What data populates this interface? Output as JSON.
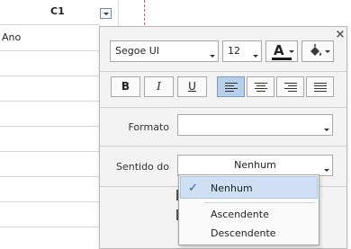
{
  "sheet": {
    "column_header": "C1",
    "cell_value": "Ano"
  },
  "panel": {
    "font_family": "Segoe UI",
    "font_size": "12",
    "font_color_glyph": "A",
    "format_buttons": [
      "B",
      "I",
      "U"
    ],
    "format_label": "Formato",
    "format_value": "",
    "sort_label": "Sentido do",
    "sort_value": "Nenhum",
    "close_glyph": "×"
  },
  "dropdown": {
    "options": [
      "Nenhum",
      "Ascendente",
      "Descendente"
    ],
    "selected_index": 0,
    "check_glyph": "✓"
  },
  "colors": {
    "selection": "#cfe0f4",
    "active_align": "#b8cfe9",
    "filter_line": "#d65a5a"
  }
}
